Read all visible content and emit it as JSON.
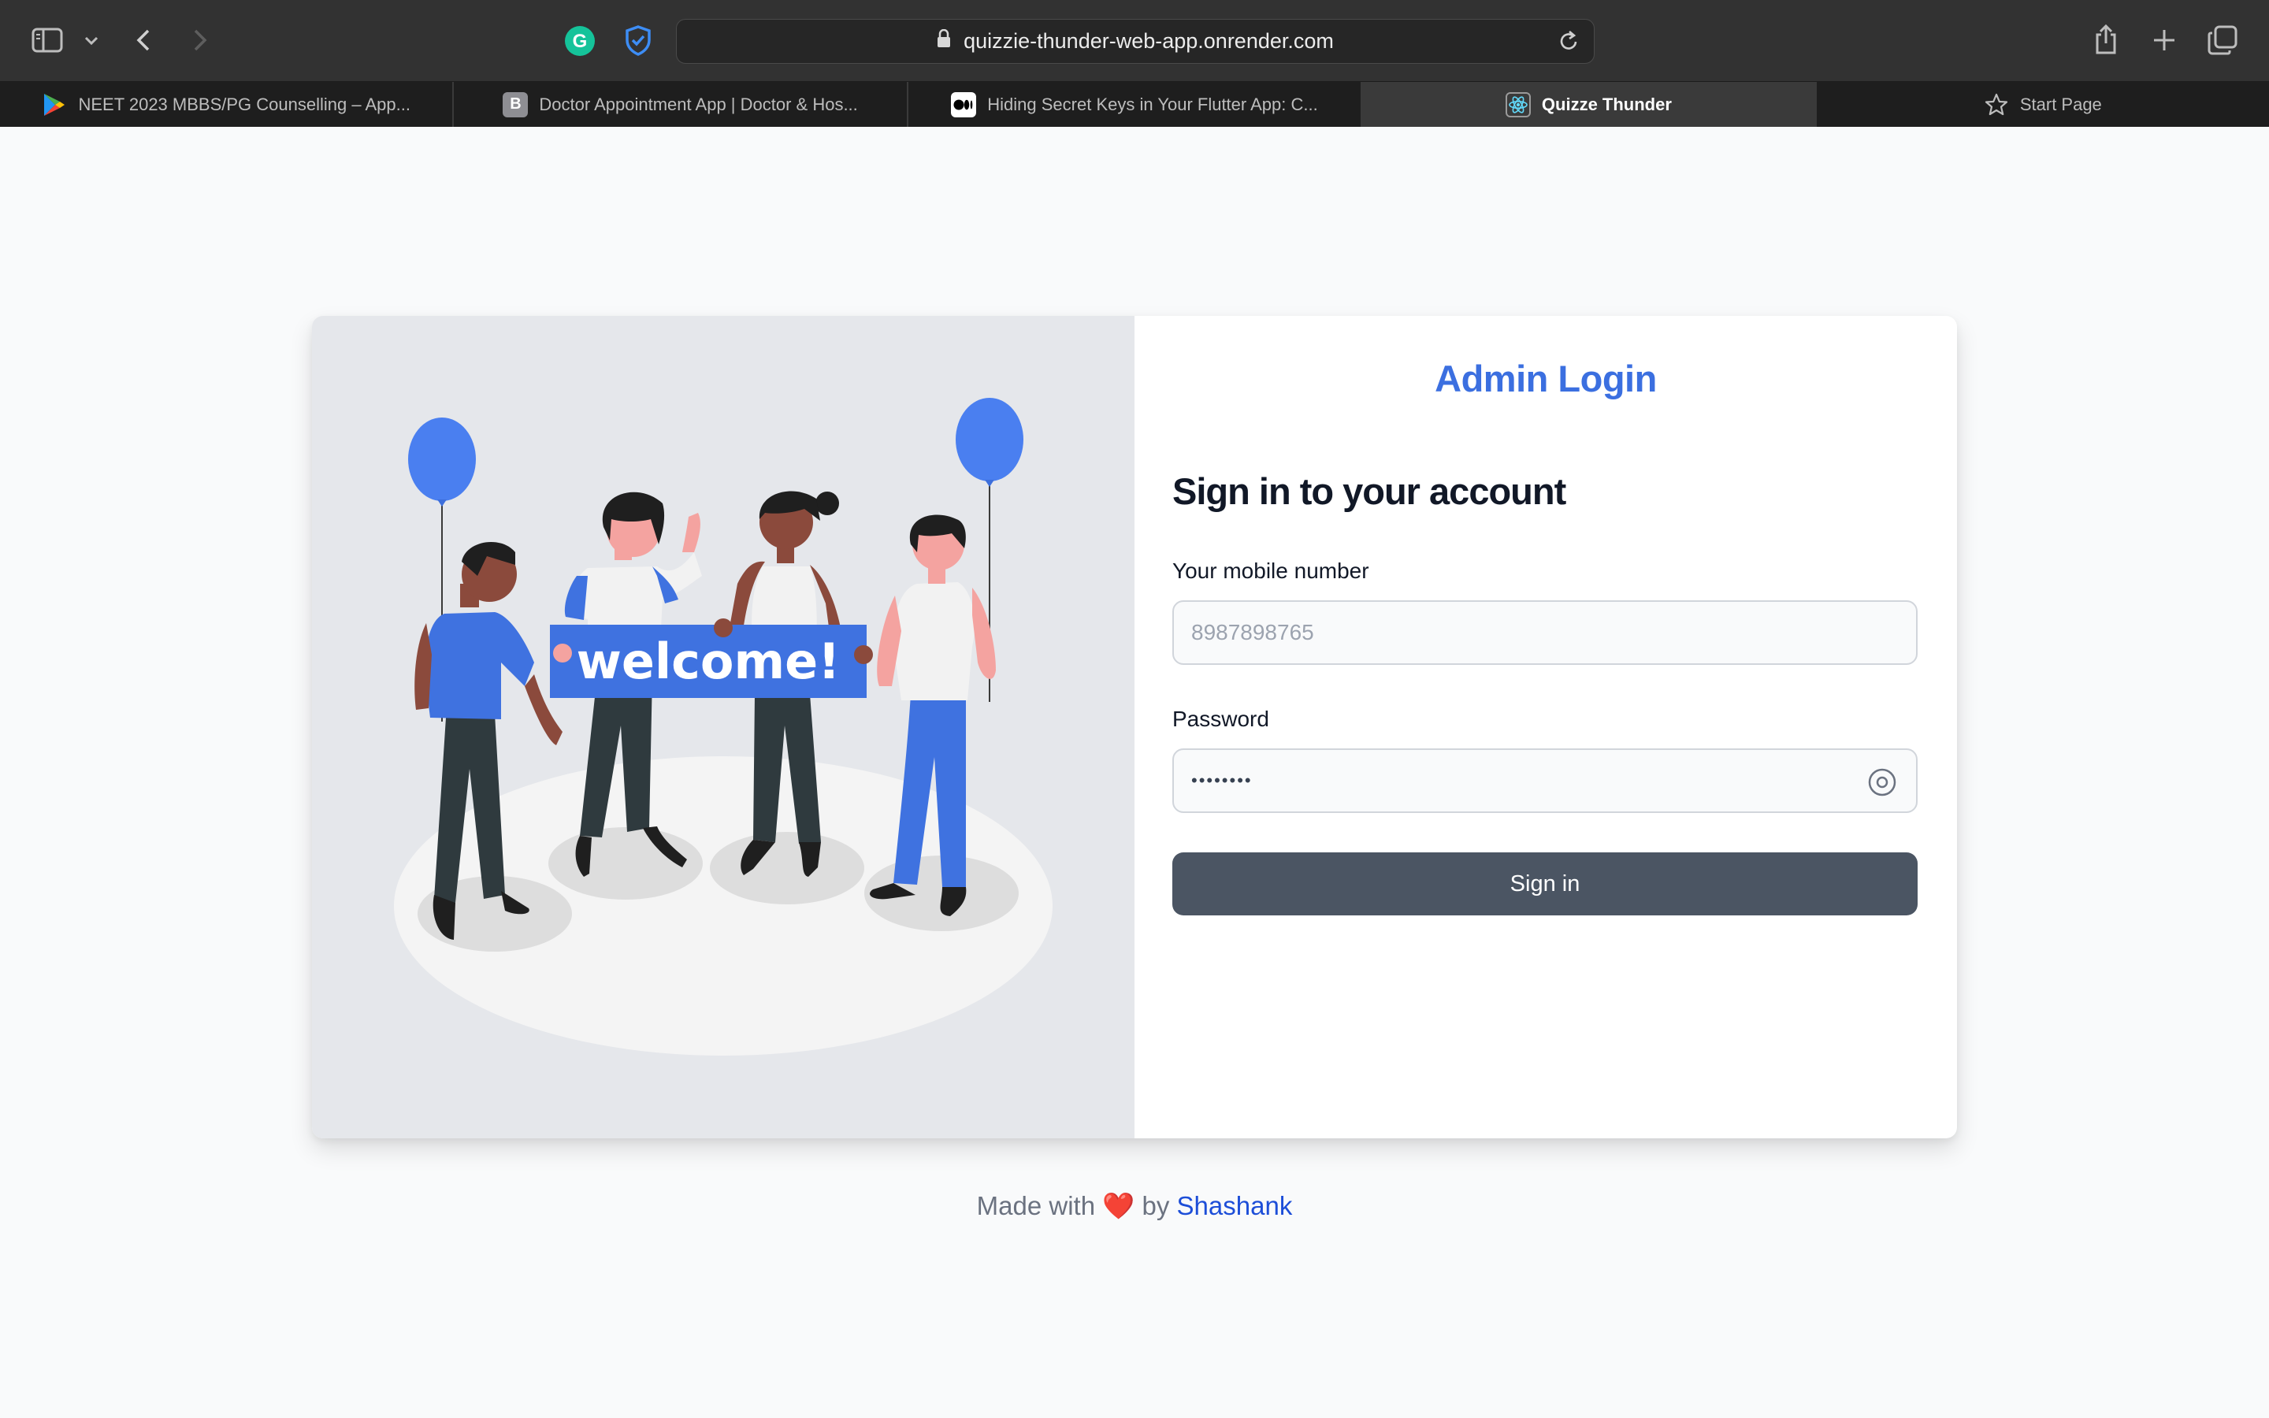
{
  "browser": {
    "url": "quizzie-thunder-web-app.onrender.com",
    "tabs": [
      {
        "title": "NEET 2023 MBBS/PG Counselling – App...",
        "favicon": "play-store-icon",
        "active": false
      },
      {
        "title": "Doctor Appointment App | Doctor & Hos...",
        "favicon": "behance-icon",
        "active": false
      },
      {
        "title": "Hiding Secret Keys in Your Flutter App: C...",
        "favicon": "medium-icon",
        "active": false
      },
      {
        "title": "Quizze Thunder",
        "favicon": "react-icon",
        "active": true
      },
      {
        "title": "Start Page",
        "favicon": "star-icon",
        "active": false
      }
    ],
    "favicon_letters": {
      "behance": "B",
      "grammarly": "G"
    }
  },
  "illustration": {
    "banner_text": "welcome!"
  },
  "login": {
    "title": "Admin Login",
    "heading": "Sign in to your account",
    "mobile_label": "Your mobile number",
    "mobile_placeholder": "8987898765",
    "password_label": "Password",
    "password_value": "••••••••",
    "submit_label": "Sign in"
  },
  "footer": {
    "prefix": "Made with",
    "heart": "❤️",
    "by": "by",
    "author": "Shashank"
  },
  "colors": {
    "accent": "#3b6fe0",
    "button": "#4b5563",
    "balloon": "#4a7ff0"
  }
}
